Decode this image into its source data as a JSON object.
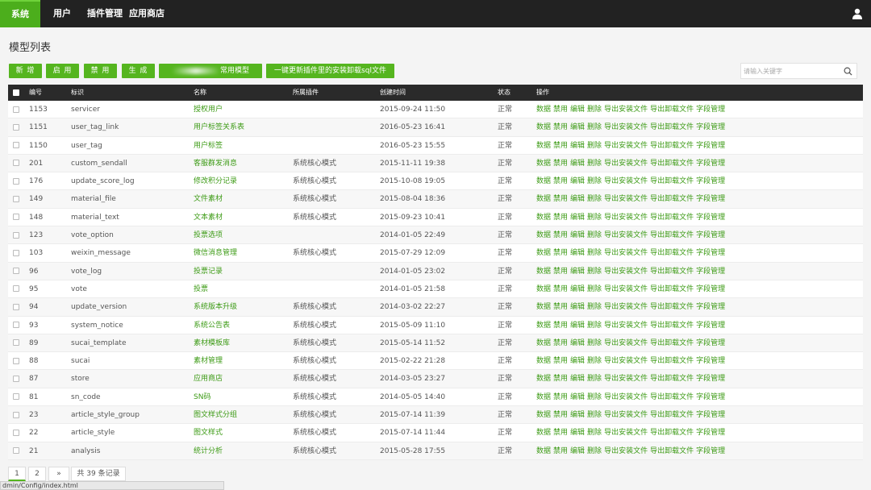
{
  "nav": {
    "items": [
      {
        "label": "系统"
      },
      {
        "label": "用户"
      },
      {
        "label": "插件管理"
      },
      {
        "label": "应用商店"
      }
    ]
  },
  "page": {
    "title": "模型列表"
  },
  "toolbar": {
    "add": "新 增",
    "enable": "启 用",
    "disable": "禁 用",
    "generate": "生 成",
    "common_model_suffix": "常用模型",
    "update_sql": "一键更新插件里的安装卸载sql文件"
  },
  "search": {
    "placeholder": "请输入关键字"
  },
  "table": {
    "headers": {
      "id": "编号",
      "ident": "标识",
      "name": "名称",
      "plugin": "所属插件",
      "time": "创建时间",
      "status": "状态",
      "ops": "操作"
    },
    "ops": [
      "数据",
      "禁用",
      "编辑",
      "删除",
      "导出安装文件",
      "导出卸载文件",
      "字段管理"
    ],
    "rows": [
      {
        "id": "1153",
        "ident": "servicer",
        "name": "授权用户",
        "plugin": "",
        "time": "2015-09-24 11:50",
        "status": "正常"
      },
      {
        "id": "1151",
        "ident": "user_tag_link",
        "name": "用户标签关系表",
        "plugin": "",
        "time": "2016-05-23 16:41",
        "status": "正常"
      },
      {
        "id": "1150",
        "ident": "user_tag",
        "name": "用户标签",
        "plugin": "",
        "time": "2016-05-23 15:55",
        "status": "正常"
      },
      {
        "id": "201",
        "ident": "custom_sendall",
        "name": "客服群发消息",
        "plugin": "系统核心模式",
        "time": "2015-11-11 19:38",
        "status": "正常"
      },
      {
        "id": "176",
        "ident": "update_score_log",
        "name": "修改积分记录",
        "plugin": "系统核心模式",
        "time": "2015-10-08 19:05",
        "status": "正常"
      },
      {
        "id": "149",
        "ident": "material_file",
        "name": "文件素材",
        "plugin": "系统核心模式",
        "time": "2015-08-04 18:36",
        "status": "正常"
      },
      {
        "id": "148",
        "ident": "material_text",
        "name": "文本素材",
        "plugin": "系统核心模式",
        "time": "2015-09-23 10:41",
        "status": "正常"
      },
      {
        "id": "123",
        "ident": "vote_option",
        "name": "投票选项",
        "plugin": "",
        "time": "2014-01-05 22:49",
        "status": "正常"
      },
      {
        "id": "103",
        "ident": "weixin_message",
        "name": "微信消息管理",
        "plugin": "系统核心模式",
        "time": "2015-07-29 12:09",
        "status": "正常"
      },
      {
        "id": "96",
        "ident": "vote_log",
        "name": "投票记录",
        "plugin": "",
        "time": "2014-01-05 23:02",
        "status": "正常"
      },
      {
        "id": "95",
        "ident": "vote",
        "name": "投票",
        "plugin": "",
        "time": "2014-01-05 21:58",
        "status": "正常"
      },
      {
        "id": "94",
        "ident": "update_version",
        "name": "系统版本升级",
        "plugin": "系统核心模式",
        "time": "2014-03-02 22:27",
        "status": "正常"
      },
      {
        "id": "93",
        "ident": "system_notice",
        "name": "系统公告表",
        "plugin": "系统核心模式",
        "time": "2015-05-09 11:10",
        "status": "正常"
      },
      {
        "id": "89",
        "ident": "sucai_template",
        "name": "素材模板库",
        "plugin": "系统核心模式",
        "time": "2015-05-14 11:52",
        "status": "正常"
      },
      {
        "id": "88",
        "ident": "sucai",
        "name": "素材管理",
        "plugin": "系统核心模式",
        "time": "2015-02-22 21:28",
        "status": "正常"
      },
      {
        "id": "87",
        "ident": "store",
        "name": "应用商店",
        "plugin": "系统核心模式",
        "time": "2014-03-05 23:27",
        "status": "正常"
      },
      {
        "id": "81",
        "ident": "sn_code",
        "name": "SN码",
        "plugin": "系统核心模式",
        "time": "2014-05-05 14:40",
        "status": "正常"
      },
      {
        "id": "23",
        "ident": "article_style_group",
        "name": "图文样式分组",
        "plugin": "系统核心模式",
        "time": "2015-07-14 11:39",
        "status": "正常"
      },
      {
        "id": "22",
        "ident": "article_style",
        "name": "图文样式",
        "plugin": "系统核心模式",
        "time": "2015-07-14 11:44",
        "status": "正常"
      },
      {
        "id": "21",
        "ident": "analysis",
        "name": "统计分析",
        "plugin": "系统核心模式",
        "time": "2015-05-28 17:55",
        "status": "正常"
      }
    ]
  },
  "pager": {
    "pages": [
      "1",
      "2"
    ],
    "next": "»",
    "total": "共 39 条记录"
  },
  "statusbar": {
    "url": "dmin/Config/index.html"
  },
  "colors": {
    "accent": "#55b51f",
    "topbar": "#222222",
    "header": "#2a2a2a",
    "link": "#3d9b16"
  }
}
